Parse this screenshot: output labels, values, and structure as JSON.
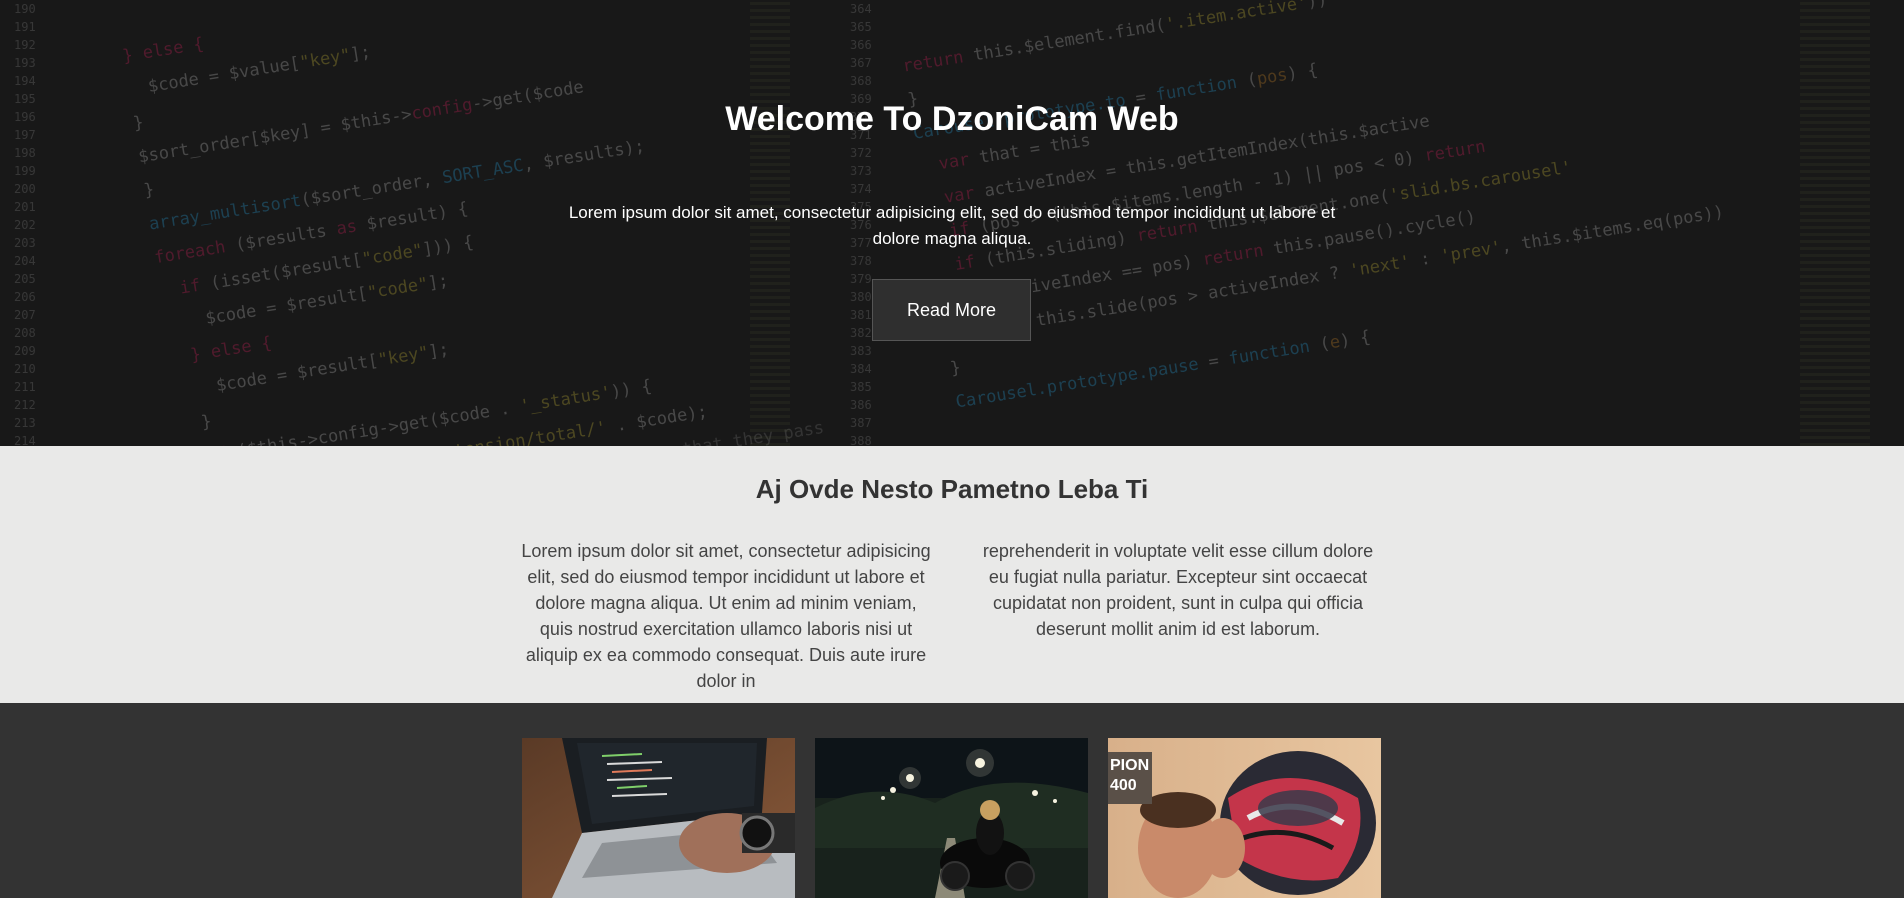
{
  "hero": {
    "title": "Welcome To DzoniCam Web",
    "text": "Lorem ipsum dolor sit amet, consectetur adipisicing elit, sed do eiusmod tempor incididunt ut labore et dolore magna aliqua.",
    "button_label": "Read More",
    "background": "code-screen-photo"
  },
  "about": {
    "title": "Aj Ovde Nesto Pametno Leba Ti",
    "col1": "Lorem ipsum dolor sit amet, consectetur adipisicing elit, sed do eiusmod tempor incididunt ut labore et dolore magna aliqua. Ut enim ad minim veniam, quis nostrud exercitation ullamco laboris nisi ut aliquip ex ea commodo consequat. Duis aute irure dolor in",
    "col2": "reprehenderit in voluptate velit esse cillum dolore eu fugiat nulla pariatur. Excepteur sint occaecat cupidatat non proident, sunt in culpa qui officia deserunt mollit anim id est laborum."
  },
  "gallery": {
    "images": [
      {
        "subject": "laptop-typing-photo"
      },
      {
        "subject": "motorcycle-night-road-photo"
      },
      {
        "subject": "helmet-portrait-photo",
        "badge": "PION\n400"
      }
    ]
  },
  "colors": {
    "hero_bg": "#1c1c1c",
    "about_bg": "#e9e9e8",
    "gallery_bg": "#333333",
    "button_bg": "#2f2f2f",
    "heading_dark": "#333333"
  }
}
